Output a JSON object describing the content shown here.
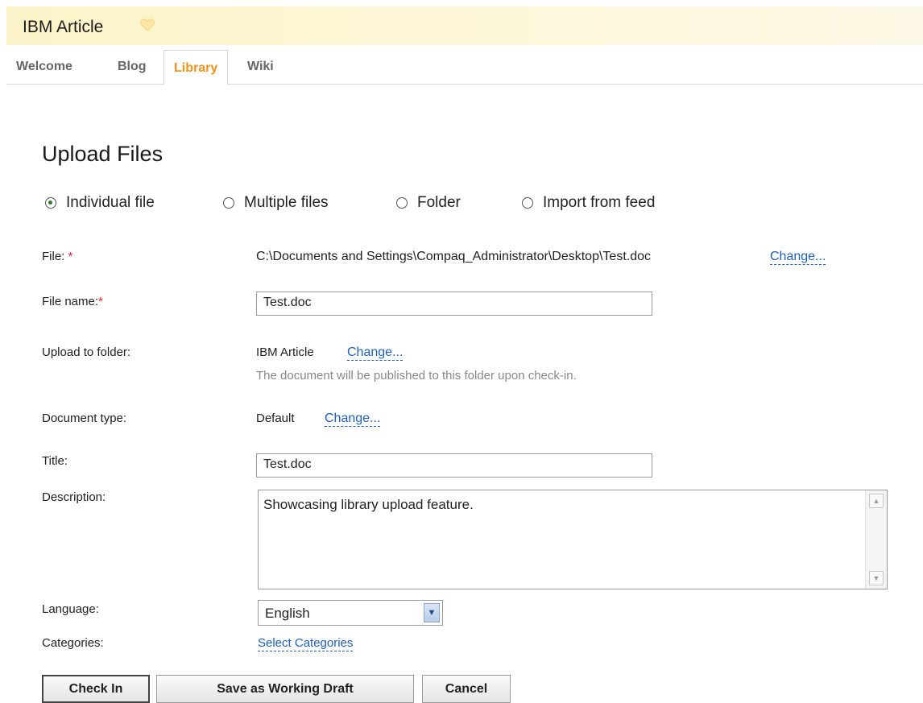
{
  "header": {
    "title": "IBM Article",
    "favorite_icon": "heart-icon"
  },
  "tabs": [
    {
      "label": "Welcome",
      "active": false
    },
    {
      "label": "Blog",
      "active": false
    },
    {
      "label": "Library",
      "active": true
    },
    {
      "label": "Wiki",
      "active": false
    }
  ],
  "page_title": "Upload Files",
  "upload_options": [
    {
      "label": "Individual file",
      "selected": true
    },
    {
      "label": "Multiple files",
      "selected": false
    },
    {
      "label": "Folder",
      "selected": false
    },
    {
      "label": "Import from feed",
      "selected": false
    }
  ],
  "form": {
    "file": {
      "label": "File:",
      "required_mark": "*",
      "value": "C:\\Documents and Settings\\Compaq_Administrator\\Desktop\\Test.doc",
      "change_link": "Change..."
    },
    "file_name": {
      "label": "File name:",
      "required_mark": "*",
      "value": "Test.doc"
    },
    "upload_folder": {
      "label": "Upload to folder:",
      "value": "IBM Article",
      "change_link": "Change...",
      "hint": "The document will be published to this folder upon check-in."
    },
    "document_type": {
      "label": "Document type:",
      "value": "Default",
      "change_link": "Change..."
    },
    "title": {
      "label": "Title:",
      "value": "Test.doc"
    },
    "description": {
      "label": "Description:",
      "value": "Showcasing library upload feature."
    },
    "language": {
      "label": "Language:",
      "value": "English"
    },
    "categories": {
      "label": "Categories:",
      "link": "Select Categories"
    }
  },
  "buttons": {
    "check_in": "Check In",
    "save_draft": "Save as Working Draft",
    "cancel": "Cancel"
  },
  "colors": {
    "active_tab": "#f39218",
    "link": "#1f5fbd",
    "required": "#e0262b",
    "header_bg": "#fdf3c8"
  }
}
